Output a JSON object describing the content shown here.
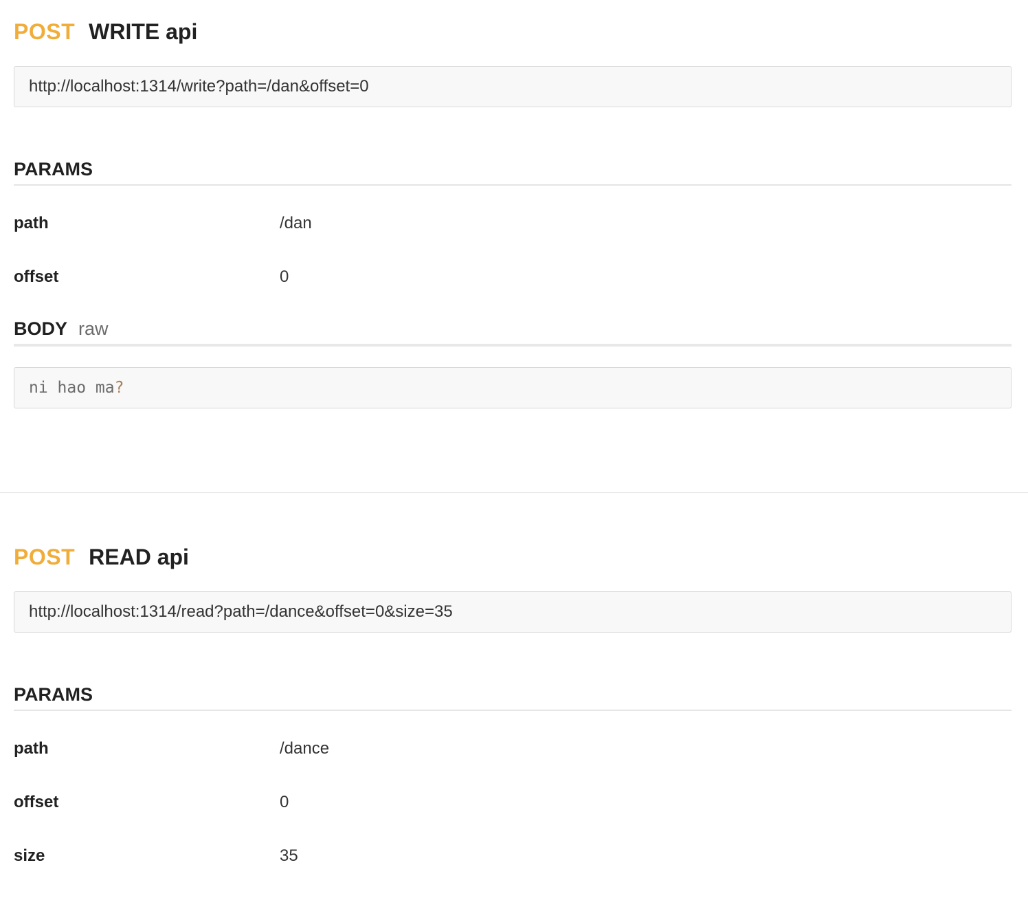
{
  "endpoints": [
    {
      "method": "POST",
      "name": "WRITE api",
      "url": "http://localhost:1314/write?path=/dan&offset=0",
      "params_title": "PARAMS",
      "params": [
        {
          "key": "path",
          "value": "/dan"
        },
        {
          "key": "offset",
          "value": "0"
        }
      ],
      "body_title": "BODY",
      "body_mode": "raw",
      "body_text": "ni hao ma",
      "body_punct": "?"
    },
    {
      "method": "POST",
      "name": "READ api",
      "url": "http://localhost:1314/read?path=/dance&offset=0&size=35",
      "params_title": "PARAMS",
      "params": [
        {
          "key": "path",
          "value": "/dance"
        },
        {
          "key": "offset",
          "value": "0"
        },
        {
          "key": "size",
          "value": "35"
        }
      ]
    }
  ],
  "colors": {
    "method": "#f0ad3a",
    "text": "#212121",
    "box_bg": "#f8f8f8"
  }
}
